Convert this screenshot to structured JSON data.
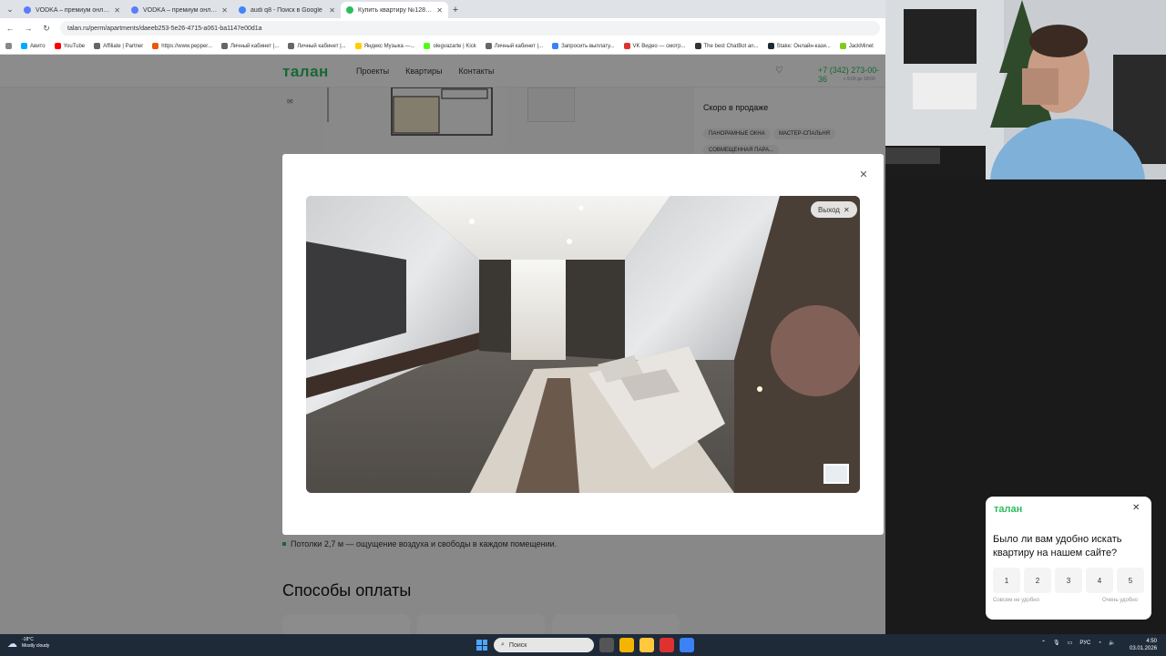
{
  "browser": {
    "tabs": [
      {
        "title": "VODKA – премиум онлайн-ка...",
        "color": "#5c7cfa"
      },
      {
        "title": "VODKA – премиум онлайн-ка...",
        "color": "#5c7cfa"
      },
      {
        "title": "audi q8 - Поиск в Google",
        "color": "#4285f4"
      },
      {
        "title": "Купить квартиру №1285 в жи...",
        "color": "#2bbd5e"
      }
    ],
    "url": "talan.ru/perm/apartments/daeeb253-5e26-4715-a061-ba1147e00d1a",
    "bookmarks": [
      "Авито",
      "YouTube",
      "Affiliate | Partner",
      "https://www.pepper...",
      "Личный кабинет |...",
      "Личный кабинет |...",
      "Яндекс Музыка —...",
      "olegvazarte | Kick",
      "Личный кабинет |...",
      "Запросить выплату...",
      "VK Видео — смотр...",
      "The best ChatBot an...",
      "Stake: Онлайн-кази...",
      "JackMinet"
    ]
  },
  "site": {
    "logo": "талан",
    "nav": [
      "Проекты",
      "Квартиры",
      "Контакты"
    ],
    "phone": "+7 (342) 273-00-36",
    "phone_hours": "с 9:00 до 18:00",
    "side_title": "Скоро в продаже",
    "chips": [
      "ПАНОРАМНЫЕ ОКНА",
      "МАСТЕР-СПАЛЬНЯ",
      "СОВМЕЩЕННАЯ ПАРА..."
    ],
    "ceiling_note": "Потолки 2,7 м — ощущение воздуха и свободы в каждом помещении.",
    "payment_title": "Способы оплаты"
  },
  "modal": {
    "exit_label": "Выход"
  },
  "survey": {
    "logo": "талан",
    "question": "Было ли вам удобно искать квартиру на нашем сайте?",
    "ratings": [
      "1",
      "2",
      "3",
      "4",
      "5"
    ],
    "low_label": "Совсем не удобно",
    "high_label": "Очень удобно"
  },
  "taskbar": {
    "temp": "-18°C",
    "weather": "Mostly cloudy",
    "search": "Поиск",
    "lang": "РУС",
    "time": "4:50",
    "date": "03.01.2026"
  },
  "colors": {
    "brand": "#2bbd5e"
  }
}
